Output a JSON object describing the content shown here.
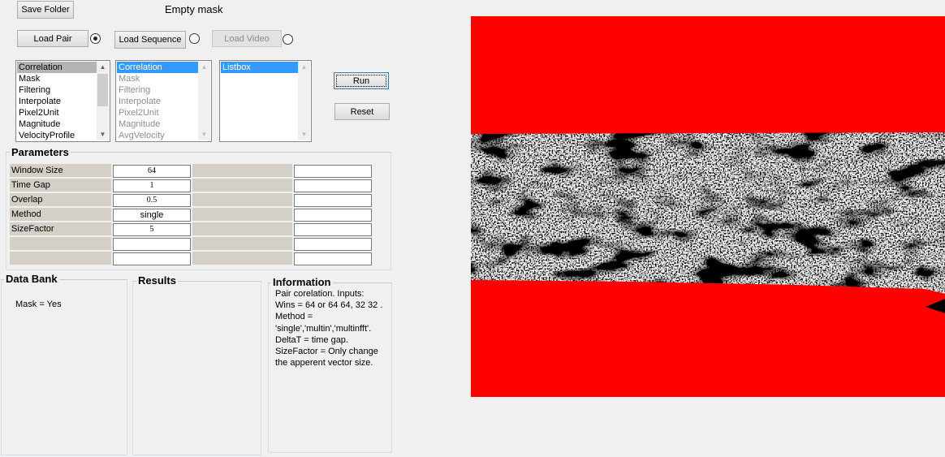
{
  "toolbar": {
    "save_folder": "Save Folder",
    "status": "Empty mask"
  },
  "loaders": {
    "load_pair": "Load Pair",
    "load_pair_selected": true,
    "load_sequence": "Load Sequence",
    "load_sequence_selected": false,
    "load_video": "Load Video",
    "load_video_selected": false
  },
  "lists": {
    "operations": [
      "Correlation",
      "Mask",
      "Filtering",
      "Interpolate",
      "Pixel2Unit",
      "Magnitude",
      "VelocityProfile"
    ],
    "operations_selected": "Correlation",
    "pipeline": [
      "Correlation",
      "Mask",
      "Filtering",
      "Interpolate",
      "Pixel2Unit",
      "Magnitude",
      "AvgVelocity"
    ],
    "pipeline_selected": "Correlation",
    "listbox": [
      "Listbox"
    ],
    "listbox_selected": "Listbox"
  },
  "actions": {
    "run": "Run",
    "reset": "Reset"
  },
  "parameters": {
    "title": "Parameters",
    "rows": [
      {
        "label": "Window Size",
        "value": "64",
        "extra": ""
      },
      {
        "label": "Time Gap",
        "value": "1",
        "extra": ""
      },
      {
        "label": "Overlap",
        "value": "0.5",
        "extra": ""
      },
      {
        "label": "Method",
        "value": "single",
        "extra": ""
      },
      {
        "label": "SizeFactor",
        "value": "5",
        "extra": ""
      },
      {
        "label": "",
        "value": "",
        "extra": ""
      },
      {
        "label": "",
        "value": "",
        "extra": ""
      }
    ]
  },
  "data_bank": {
    "title": "Data Bank",
    "text": "Mask = Yes"
  },
  "results": {
    "title": "Results"
  },
  "information": {
    "title": "Information",
    "lines": [
      "Pair corelation. Inputs:",
      "Wins = 64 or 64 64, 32 32 .",
      "Method =",
      "'single','multin','multinfft'.",
      "DeltaT = time gap.",
      "SizeFactor = Only change",
      "the apperent vector size."
    ]
  },
  "image_view": {
    "mask_color": "#ff0000"
  }
}
